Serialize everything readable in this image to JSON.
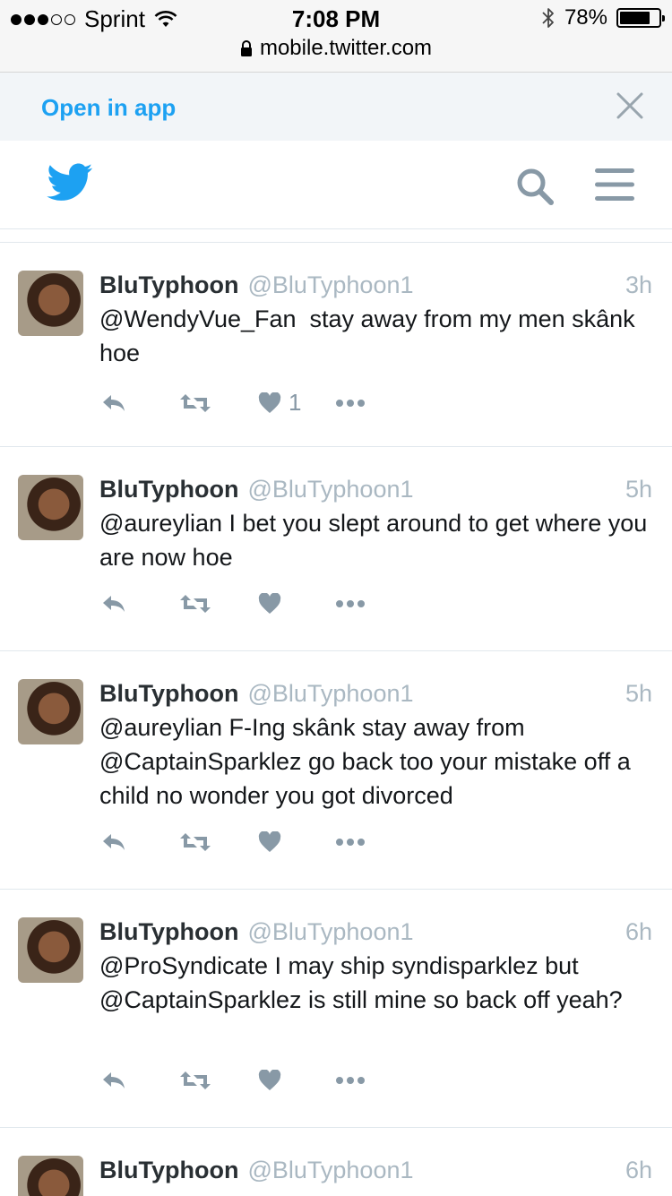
{
  "status_bar": {
    "carrier": "Sprint",
    "time": "7:08 PM",
    "url": "mobile.twitter.com",
    "battery_percent_label": "78%",
    "battery_level": 0.78
  },
  "open_app": {
    "label": "Open in app"
  },
  "colors": {
    "brand_blue": "#1da1f2",
    "icon_gray": "#8899a6",
    "handle_gray": "#aab8c2"
  },
  "tweets": [
    {
      "name": "BluTyphoon",
      "handle": "@BluTyphoon1",
      "time": "3h",
      "text": "@WendyVue_Fan  stay away from my men skânk hoe",
      "likes": "1"
    },
    {
      "name": "BluTyphoon",
      "handle": "@BluTyphoon1",
      "time": "5h",
      "text": "@aureylian I bet you slept around to get where you are now hoe",
      "likes": ""
    },
    {
      "name": "BluTyphoon",
      "handle": "@BluTyphoon1",
      "time": "5h",
      "text": "@aureylian F-Ing skânk stay away from @CaptainSparklez go back too your mistake off a child no wonder you got divorced",
      "likes": ""
    },
    {
      "name": "BluTyphoon",
      "handle": "@BluTyphoon1",
      "time": "6h",
      "text": "@ProSyndicate I may ship syndisparklez but @CaptainSparklez is still mine so back off yeah?",
      "likes": ""
    },
    {
      "name": "BluTyphoon",
      "handle": "@BluTyphoon1",
      "time": "6h",
      "text": "",
      "likes": ""
    }
  ]
}
